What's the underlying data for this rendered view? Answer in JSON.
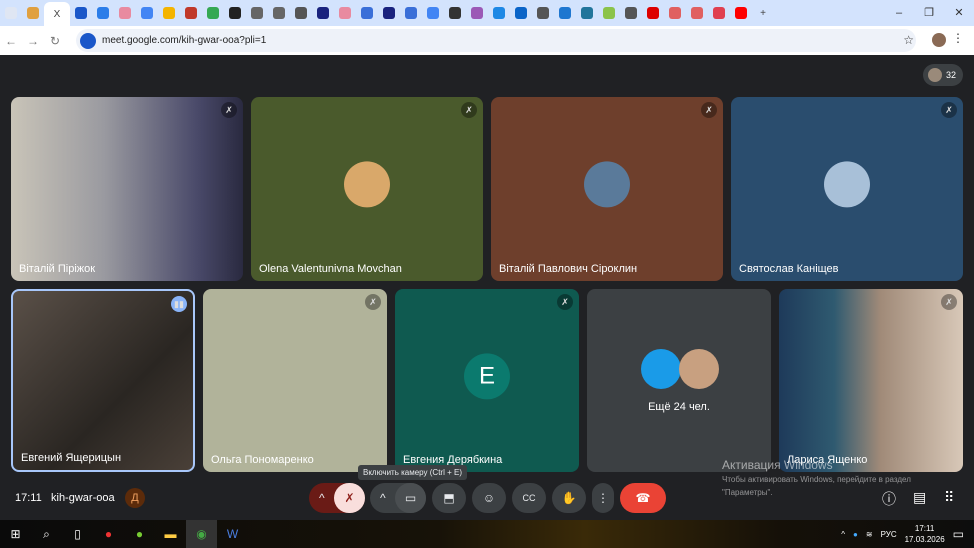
{
  "browser": {
    "tabs": [
      {
        "icon": "chevron-down-icon",
        "color": "#dfe6f3"
      },
      {
        "icon": "app-icon",
        "color": "#e0a040"
      },
      {
        "icon": "close-icon",
        "label": "X",
        "active": true
      },
      {
        "icon": "ai-icon",
        "color": "#1a57c9"
      },
      {
        "icon": "doc-icon",
        "color": "#2b7de9"
      },
      {
        "icon": "circle-icon",
        "color": "#e88aa0"
      },
      {
        "icon": "google-icon",
        "color": "#4285f4"
      },
      {
        "icon": "pinwheel-icon",
        "color": "#f4b400"
      },
      {
        "icon": "s-icon",
        "color": "#c0392b"
      },
      {
        "icon": "pinwheel-icon",
        "color": "#34a853"
      },
      {
        "icon": "black-icon",
        "color": "#222"
      },
      {
        "icon": "pdf-icon",
        "color": "#666"
      },
      {
        "icon": "pdf-icon",
        "color": "#666"
      },
      {
        "icon": "globe-icon",
        "color": "#555"
      },
      {
        "icon": "book-icon",
        "color": "#1a237e"
      },
      {
        "icon": "circle-icon",
        "color": "#e88aa0"
      },
      {
        "icon": "arrow-icon",
        "color": "#3a6fd8"
      },
      {
        "icon": "book-icon",
        "color": "#1a237e"
      },
      {
        "icon": "arrow-icon",
        "color": "#3a6fd8"
      },
      {
        "icon": "google-icon",
        "color": "#4285f4"
      },
      {
        "icon": "face-icon",
        "color": "#333"
      },
      {
        "icon": "copilot-icon",
        "color": "#9b59b6"
      },
      {
        "icon": "calendar-icon",
        "color": "#1e88e5"
      },
      {
        "icon": "outlook-icon",
        "color": "#0a64c8"
      },
      {
        "icon": "globe-icon",
        "color": "#555"
      },
      {
        "icon": "edge-icon",
        "color": "#1f77d0"
      },
      {
        "icon": "wordpress-icon",
        "color": "#21759b"
      },
      {
        "icon": "b-icon",
        "color": "#8bc34a"
      },
      {
        "icon": "globe-icon",
        "color": "#555"
      },
      {
        "icon": "red-dot-icon",
        "color": "#d00"
      },
      {
        "icon": "red-icon",
        "color": "#e06060"
      },
      {
        "icon": "red-icon",
        "color": "#e06060"
      },
      {
        "icon": "red-icon",
        "color": "#e04050"
      },
      {
        "icon": "youtube-icon",
        "color": "#f00"
      }
    ],
    "new_tab": "+",
    "window": {
      "minimize": "–",
      "maximize": "❐",
      "close": "✕"
    },
    "url": "meet.google.com/kih-gwar-ooa?pli=1"
  },
  "meet": {
    "participant_count": "32",
    "tiles": [
      {
        "name": "Віталій Піріжок",
        "bg": "#8a8c90"
      },
      {
        "name": "Olena Valentunivna Movchan",
        "bg": "#4a5a2c"
      },
      {
        "name": "Віталій Павлович Сіроклин",
        "bg": "#6e3f2c"
      },
      {
        "name": "Святослав Каніщев",
        "bg": "#2a4d6e"
      },
      {
        "name": "Евгений Ящерицын",
        "bg": "#3a3530"
      },
      {
        "name": "Ольга Пономаренко",
        "bg": "#b1b39a"
      },
      {
        "name": "Евгения Дерябкина",
        "bg": "#0f5a50",
        "initial": "E"
      },
      {
        "name": "Ещё 24 чел.",
        "bg": "#3c4043"
      },
      {
        "name": "Лариса Ященко",
        "bg": "#7a6a5e"
      }
    ],
    "time": "17:11",
    "meeting_code": "kih-gwar-ooa",
    "tooltip": "Включить камеру (Ctrl + E)",
    "end_call_color": "#ea4335"
  },
  "activation": {
    "title": "Активация Windows",
    "text": "Чтобы активировать Windows, перейдите в раздел \"Параметры\"."
  },
  "taskbar": {
    "lang": "РУС",
    "time": "17:11",
    "date": "17.03.2026"
  }
}
